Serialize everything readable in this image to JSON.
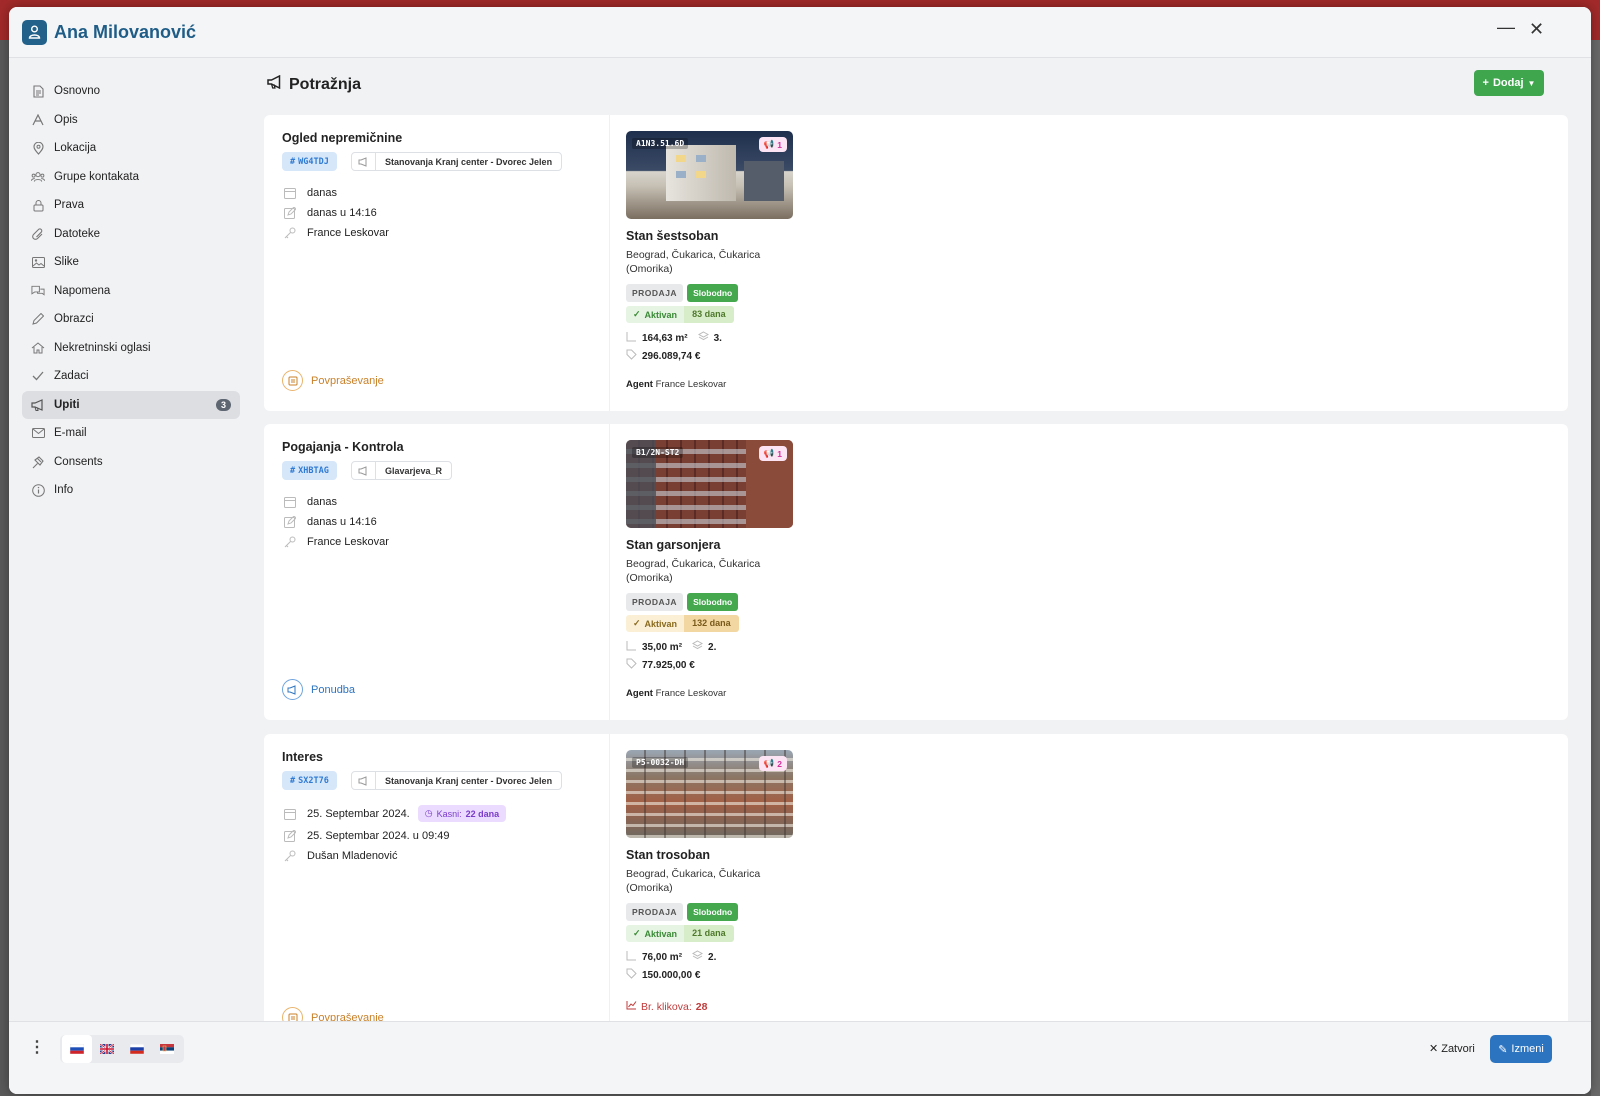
{
  "window": {
    "title": "Ana Milovanović"
  },
  "sidebar": {
    "items": [
      {
        "label": "Osnovno",
        "icon": "document-icon"
      },
      {
        "label": "Opis",
        "icon": "text-icon"
      },
      {
        "label": "Lokacija",
        "icon": "map-pin-icon"
      },
      {
        "label": "Grupe kontakata",
        "icon": "users-icon"
      },
      {
        "label": "Prava",
        "icon": "lock-icon"
      },
      {
        "label": "Datoteke",
        "icon": "paperclip-icon"
      },
      {
        "label": "Slike",
        "icon": "image-icon"
      },
      {
        "label": "Napomena",
        "icon": "comments-icon"
      },
      {
        "label": "Obrazci",
        "icon": "pen-icon"
      },
      {
        "label": "Nekretninski oglasi",
        "icon": "home-icon"
      },
      {
        "label": "Zadaci",
        "icon": "check-icon"
      },
      {
        "label": "Upiti",
        "icon": "megaphone-icon",
        "badge": "3",
        "active": true
      },
      {
        "label": "E-mail",
        "icon": "envelope-icon"
      },
      {
        "label": "Consents",
        "icon": "gavel-icon"
      },
      {
        "label": "Info",
        "icon": "info-icon"
      }
    ]
  },
  "main": {
    "title": "Potražnja",
    "add_label": "Dodaj"
  },
  "inquiries": [
    {
      "title": "Ogled nepremičnine",
      "code": "WG4TDJ",
      "source": "Stanovanja Kranj center - Dvorec Jelen",
      "date": "danas",
      "modified": "danas u 14:16",
      "person": "France Leskovar",
      "type": "Povpraševanje",
      "property": {
        "code": "A1N3.51.6D",
        "count": "1",
        "name": "Stan šestsoban",
        "location": "Beograd, Čukarica, Čukarica (Omorika)",
        "deal": "PRODAJA",
        "status": "Slobodno",
        "active": "Aktivan",
        "days": "83 dana",
        "area": "164,63 m²",
        "floor": "3.",
        "price": "296.089,74 €",
        "agent_label": "Agent",
        "agent": "France Leskovar"
      }
    },
    {
      "title": "Pogajanja - Kontrola",
      "code": "XHBTAG",
      "source": "Glavarjeva_R",
      "date": "danas",
      "modified": "danas u 14:16",
      "person": "France Leskovar",
      "type": "Ponudba",
      "property": {
        "code": "B1/2N-ST2",
        "count": "1",
        "name": "Stan garsonjera",
        "location": "Beograd, Čukarica, Čukarica (Omorika)",
        "deal": "PRODAJA",
        "status": "Slobodno",
        "active": "Aktivan",
        "days": "132 dana",
        "area": "35,00 m²",
        "floor": "2.",
        "price": "77.925,00 €",
        "agent_label": "Agent",
        "agent": "France Leskovar"
      }
    },
    {
      "title": "Interes",
      "code": "SX2T76",
      "source": "Stanovanja Kranj center - Dvorec Jelen",
      "date": "25. Septembar 2024.",
      "late_label": "Kasni:",
      "late_value": "22 dana",
      "modified": "25. Septembar 2024. u 09:49",
      "person": "Dušan Mladenović",
      "type": "Povpraševanje",
      "property": {
        "code": "P5-0032-DH",
        "count": "2",
        "name": "Stan trosoban",
        "location": "Beograd, Čukarica, Čukarica (Omorika)",
        "deal": "PRODAJA",
        "status": "Slobodno",
        "active": "Aktivan",
        "days": "21 dana",
        "area": "76,00 m²",
        "floor": "2.",
        "price": "150.000,00 €",
        "clicks_label": "Br. klikova:",
        "clicks": "28"
      }
    }
  ],
  "footer": {
    "languages": [
      "sl",
      "en",
      "ru",
      "sr"
    ],
    "close_label": "Zatvori",
    "edit_label": "Izmeni"
  },
  "colors": {
    "accent": "#1f5d87",
    "add_button": "#3fa64e",
    "edit_button": "#2d74c0",
    "status_green": "#45a84f",
    "late_purple": "#7a3cc9"
  }
}
